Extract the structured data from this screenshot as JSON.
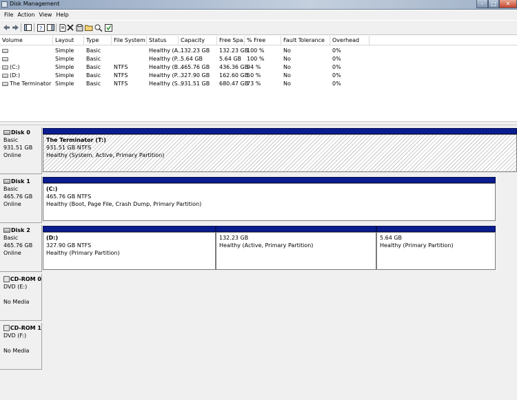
{
  "window": {
    "title": "Disk Management",
    "buttons": {
      "minimize": "–",
      "maximize": "□",
      "close": "✕"
    }
  },
  "menu": [
    "File",
    "Action",
    "View",
    "Help"
  ],
  "toolbar": {
    "icons": [
      "back-icon",
      "forward-icon",
      "show-hide-console-tree-icon",
      "help-icon",
      "show-hide-action-pane-icon",
      "properties-icon",
      "delete-icon",
      "settings-icon",
      "open-icon",
      "explore-icon",
      "refresh-icon"
    ]
  },
  "volumes": {
    "columns": [
      "Volume",
      "Layout",
      "Type",
      "File System",
      "Status",
      "Capacity",
      "Free Spa...",
      "% Free",
      "Fault Tolerance",
      "Overhead"
    ],
    "rows": [
      {
        "volume": "",
        "layout": "Simple",
        "type": "Basic",
        "fs": "",
        "status": "Healthy (A...",
        "capacity": "132.23 GB",
        "free": "132.23 GB",
        "pct": "100 %",
        "fault": "No",
        "overhead": "0%"
      },
      {
        "volume": "",
        "layout": "Simple",
        "type": "Basic",
        "fs": "",
        "status": "Healthy (P...",
        "capacity": "5.64 GB",
        "free": "5.64 GB",
        "pct": "100 %",
        "fault": "No",
        "overhead": "0%"
      },
      {
        "volume": "(C:)",
        "layout": "Simple",
        "type": "Basic",
        "fs": "NTFS",
        "status": "Healthy (B...",
        "capacity": "465.76 GB",
        "free": "436.36 GB",
        "pct": "94 %",
        "fault": "No",
        "overhead": "0%"
      },
      {
        "volume": "(D:)",
        "layout": "Simple",
        "type": "Basic",
        "fs": "NTFS",
        "status": "Healthy (P...",
        "capacity": "327.90 GB",
        "free": "162.60 GB",
        "pct": "50 %",
        "fault": "No",
        "overhead": "0%"
      },
      {
        "volume": "The Terminator (T:)",
        "layout": "Simple",
        "type": "Basic",
        "fs": "NTFS",
        "status": "Healthy (S...",
        "capacity": "931.51 GB",
        "free": "680.47 GB",
        "pct": "73 %",
        "fault": "No",
        "overhead": "0%"
      }
    ]
  },
  "disks": [
    {
      "name": "Disk 0",
      "kind": "Basic",
      "size": "931.51 GB",
      "state": "Online",
      "partitions": [
        {
          "title": "The Terminator  (T:)",
          "size": "931.51 GB NTFS",
          "status": "Healthy (System, Active, Primary Partition)"
        }
      ]
    },
    {
      "name": "Disk 1",
      "kind": "Basic",
      "size": "465.76 GB",
      "state": "Online",
      "partitions": [
        {
          "title": "(C:)",
          "size": "465.76 GB NTFS",
          "status": "Healthy (Boot, Page File, Crash Dump, Primary Partition)"
        }
      ]
    },
    {
      "name": "Disk 2",
      "kind": "Basic",
      "size": "465.76 GB",
      "state": "Online",
      "partitions": [
        {
          "title": "(D:)",
          "size": "327.90 GB NTFS",
          "status": "Healthy (Primary Partition)"
        },
        {
          "title": "",
          "size": "132.23 GB",
          "status": "Healthy (Active, Primary Partition)"
        },
        {
          "title": "",
          "size": "5.64 GB",
          "status": "Healthy (Primary Partition)"
        }
      ]
    }
  ],
  "cdroms": [
    {
      "name": "CD-ROM 0",
      "drive": "DVD (E:)",
      "media": "No Media"
    },
    {
      "name": "CD-ROM 1",
      "drive": "DVD (F:)",
      "media": "No Media"
    }
  ]
}
